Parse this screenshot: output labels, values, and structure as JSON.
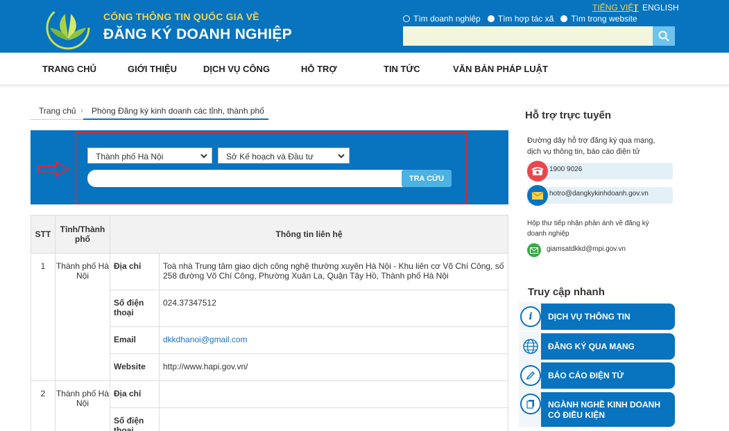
{
  "header": {
    "subtitle": "CỔNG THÔNG TIN QUỐC GIA VỀ",
    "title": "ĐĂNG KÝ DOANH NGHIỆP",
    "lang_vi": "TIẾNG VIỆT",
    "lang_sep": "|",
    "lang_en": "ENGLISH",
    "search_options": [
      "Tìm doanh nghiệp",
      "Tìm hợp tác xã",
      "Tìm trong website"
    ],
    "search_value": ""
  },
  "nav": [
    "TRANG CHỦ",
    "GIỚI THIỆU",
    "DỊCH VỤ CÔNG",
    "HỖ TRỢ",
    "TIN TỨC",
    "VĂN BẢN PHÁP LUẬT"
  ],
  "breadcrumb": {
    "home": "Trang chủ",
    "arrow": "›",
    "current": "Phòng Đăng ký kinh doanh các tỉnh, thành phố"
  },
  "lookup": {
    "province": "Thành phố Hà Nội",
    "agency": "Sở Kế hoạch và Đầu tư",
    "keyword": "",
    "button": "TRA CỨU"
  },
  "table": {
    "headers": {
      "stt": "STT",
      "province": "Tỉnh/Thành phố",
      "contact": "Thông tin liên hệ"
    },
    "rows": [
      {
        "stt": "1",
        "province": "Thành phố Hà Nội",
        "address_label": "Địa chỉ",
        "address": "Toà nhà Trung tâm giao dịch công nghệ thường xuyên Hà Nội - Khu liên cơ Võ Chí Công, số 258 đường Võ Chí Công, Phường Xuân La, Quận Tây Hồ, Thành phố Hà Nội",
        "phone_label": "Số điện thoại",
        "phone": "024.37347512",
        "email_label": "Email",
        "email": "dkkdhanoi@gmail.com",
        "website_label": "Website",
        "website": "http://www.hapi.gov.vn/"
      },
      {
        "stt": "2",
        "province": "Thành phố Hà Nội",
        "address_label": "Địa chỉ",
        "address": "",
        "phone_label": "Số điện thoại"
      }
    ]
  },
  "sidebar": {
    "support_title": "Hỗ trợ trực tuyến",
    "support_text": "Đường dây hỗ trợ đăng ký qua mạng, dịch vụ thông tin, báo cáo điện tử",
    "phone": "1900 9026",
    "email": "hotro@dangkykinhdoanh.gov.vn",
    "feedback_text": "Hộp thư tiếp nhận phản ánh về đăng ký doanh nghiệp",
    "feedback_email": "giamsatdkkd@mpi.gov.vn",
    "quick_title": "Truy cập nhanh",
    "quick_links": [
      "DỊCH VỤ THÔNG TIN",
      "ĐĂNG KÝ QUA MẠNG",
      "BÁO CÁO ĐIỆN TỬ",
      "NGÀNH NGHỀ KINH DOANH CÓ ĐIỀU KIỆN"
    ]
  },
  "colors": {
    "brand_blue": "#0873bf",
    "accent_yellow": "#f5d24a",
    "highlight_red": "#d82b33",
    "button_blue": "#4cb1e3"
  }
}
